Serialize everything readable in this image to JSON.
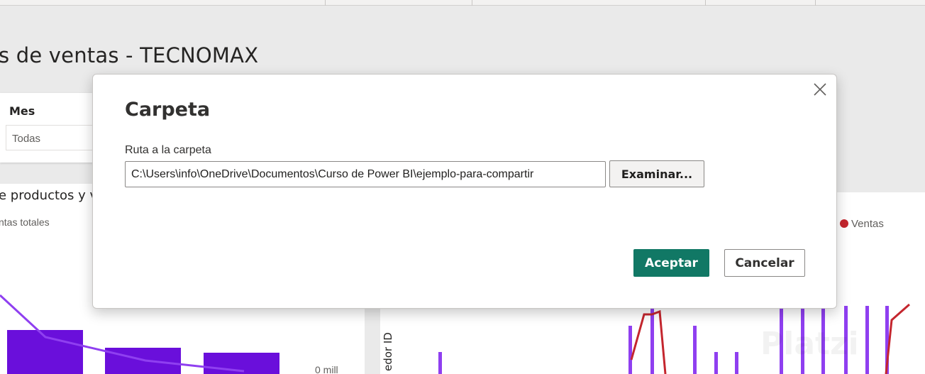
{
  "colors": {
    "accent": "#117865",
    "bar_purple": "#6a0fdb",
    "line_purple": "#8f3ff0",
    "line_red": "#c4262e"
  },
  "report": {
    "title_fragment": "s de ventas - TECNOMAX"
  },
  "slicer": {
    "title": "Mes",
    "value": "Todas"
  },
  "left_visual": {
    "title_fragment": "e productos y v",
    "legend_fragment": "ntas totales",
    "axis_label": "0 mill"
  },
  "right_visual": {
    "legend_label": "Ventas",
    "y_axis_fragment": "edor ID"
  },
  "watermark": "Platzi",
  "dialog": {
    "title": "Carpeta",
    "close_icon": "close-icon",
    "field_label": "Ruta a la carpeta",
    "path_value": "C:\\Users\\info\\OneDrive\\Documentos\\Curso de Power BI\\ejemplo-para-compartir",
    "browse_label": "Examinar...",
    "ok_label": "Aceptar",
    "cancel_label": "Cancelar"
  }
}
